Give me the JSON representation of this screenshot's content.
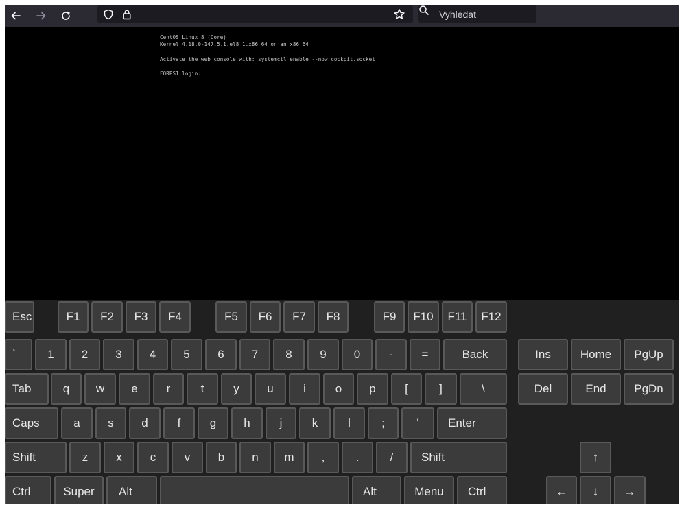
{
  "toolbar": {
    "back_icon": "arrow-left-icon",
    "forward_icon": "arrow-right-icon",
    "reload_icon": "reload-icon",
    "shield_icon": "shield-icon",
    "lock_icon": "lock-icon",
    "bookmark_icon": "star-icon",
    "search_icon": "search-icon",
    "search_placeholder": "Vyhledat"
  },
  "terminal": {
    "lines": [
      "CentOS Linux 8 (Core)",
      "Kernel 4.18.0-147.5.1.el8_1.x86_64 on an x86_64",
      "Activate the web console with: systemctl enable --now cockpit.socket",
      "FORPSI login:"
    ]
  },
  "keyboard": {
    "fn_row": [
      "Esc",
      "F1",
      "F2",
      "F3",
      "F4",
      "F5",
      "F6",
      "F7",
      "F8",
      "F9",
      "F10",
      "F11",
      "F12"
    ],
    "number_row": [
      "`",
      "1",
      "2",
      "3",
      "4",
      "5",
      "6",
      "7",
      "8",
      "9",
      "0",
      "-",
      "=",
      "Back"
    ],
    "top_row": [
      "Tab",
      "q",
      "w",
      "e",
      "r",
      "t",
      "y",
      "u",
      "i",
      "o",
      "p",
      "[",
      "]",
      "\\"
    ],
    "home_row": [
      "Caps",
      "a",
      "s",
      "d",
      "f",
      "g",
      "h",
      "j",
      "k",
      "l",
      ";",
      "'",
      "Enter"
    ],
    "bottom_row": [
      "Shift",
      "z",
      "x",
      "c",
      "v",
      "b",
      "n",
      "m",
      ",",
      ".",
      "/",
      "Shift"
    ],
    "space_row": [
      "Ctrl",
      "Super",
      "Alt",
      "",
      "Alt",
      "Menu",
      "Ctrl"
    ],
    "nav_top": [
      "Ins",
      "Home",
      "PgUp"
    ],
    "nav_bottom": [
      "Del",
      "End",
      "PgDn"
    ],
    "arrows": [
      "↑",
      "←",
      "↓",
      "→"
    ]
  }
}
